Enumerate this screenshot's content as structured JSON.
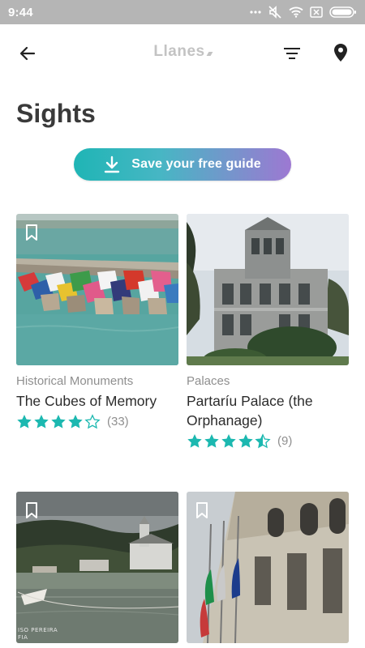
{
  "status_bar": {
    "time": "9:44",
    "icons": [
      "more-dots-icon",
      "mute-icon",
      "wifi-icon",
      "sim-icon",
      "battery-icon"
    ]
  },
  "app_bar": {
    "logo": "Llanes",
    "back_icon": "arrow-left-icon",
    "filter_icon": "filter-icon",
    "map_icon": "location-pin-icon"
  },
  "page": {
    "title": "Sights"
  },
  "cta": {
    "label": "Save your free guide",
    "icon": "download-icon",
    "colors": [
      "#1fb5b5",
      "#9d78d2"
    ]
  },
  "accent_color": "#1cb8b0",
  "cards": [
    {
      "category": "Historical Monuments",
      "title": "The Cubes of Memory",
      "rating": 4,
      "rating_count": "(33)"
    },
    {
      "category": "Palaces",
      "title": "Partaríu Palace (the Orphanage)",
      "rating": 4.5,
      "rating_count": "(9)"
    },
    {
      "photo_credit": "ISO PEREIRA\nFIA"
    },
    {}
  ]
}
